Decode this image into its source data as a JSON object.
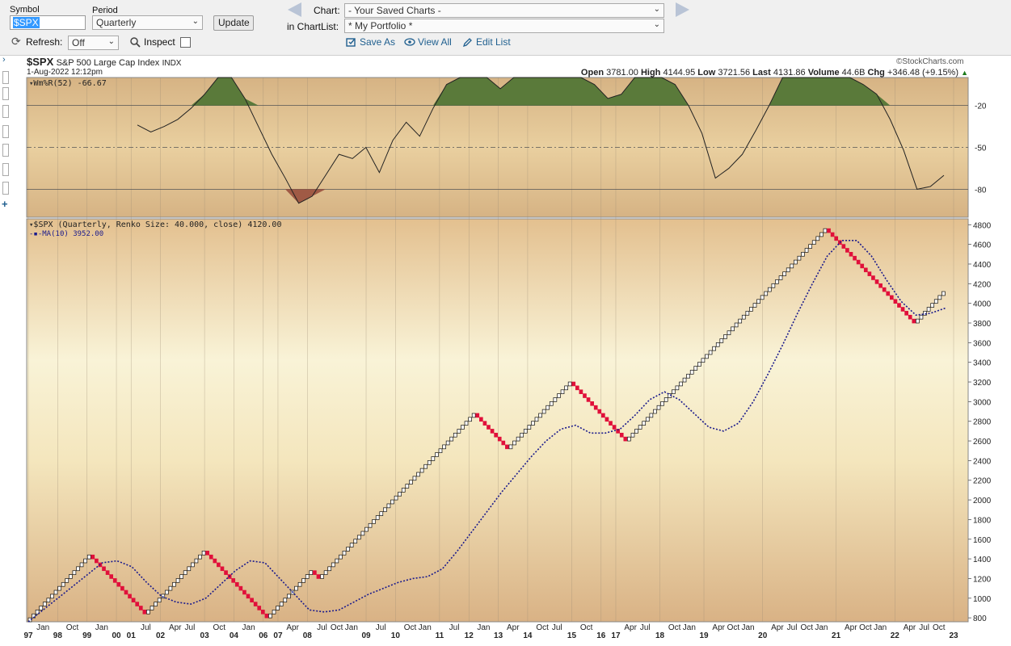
{
  "toolbar": {
    "symbol_label": "Symbol",
    "symbol_value": "$SPX",
    "period_label": "Period",
    "period_value": "Quarterly",
    "update_label": "Update",
    "refresh_label": "Refresh:",
    "refresh_value": "Off",
    "inspect_label": "Inspect",
    "chart_label": "Chart:",
    "chart_value": "- Your Saved Charts -",
    "chartlist_label": "in ChartList:",
    "chartlist_value": "* My Portfolio *",
    "save_as": "Save As",
    "view_all": "View All",
    "edit_list": "Edit List"
  },
  "header": {
    "symbol": "$SPX",
    "name": "S&P 500 Large Cap Index",
    "exchange": "INDX",
    "date": "1-Aug-2022 12:12pm",
    "brand": "©StockCharts.com",
    "open_label": "Open",
    "open": "3781.00",
    "high_label": "High",
    "high": "4144.95",
    "low_label": "Low",
    "low": "3721.56",
    "last_label": "Last",
    "last": "4131.86",
    "volume_label": "Volume",
    "volume": "44.6B",
    "chg_label": "Chg",
    "chg": "+346.48 (+9.15%)",
    "chg_arrow": "▲"
  },
  "colors": {
    "up_brick": "#ffffff",
    "down_brick": "#e0103a",
    "ma_line": "#1a1a8c",
    "overbought_fill": "#5a7a3a",
    "oversold_fill": "#a05a45"
  },
  "chart_data": [
    {
      "type": "line",
      "title": "Wm%R(52) -66.67",
      "ylim": [
        -100,
        0
      ],
      "yticks": [
        "-20",
        "-50",
        "-80"
      ],
      "reference_lines": [
        -20,
        -50,
        -80
      ],
      "overbought": -20,
      "oversold": -80,
      "x": [
        "1999-01",
        "1999-04",
        "1999-07",
        "2000-01",
        "2000-07",
        "2001-01",
        "2001-04",
        "2001-07",
        "2001-10",
        "2002-01",
        "2002-04",
        "2002-07",
        "2002-10",
        "2003-01",
        "2003-04",
        "2003-07",
        "2004-01",
        "2004-07",
        "2005-01",
        "2005-07",
        "2006-01",
        "2006-07",
        "2007-01",
        "2007-07",
        "2008-01",
        "2008-07",
        "2009-01",
        "2009-04",
        "2009-07",
        "2010-01",
        "2010-04",
        "2010-07",
        "2011-01",
        "2011-04",
        "2011-07",
        "2012-01",
        "2012-07",
        "2013-01",
        "2013-07",
        "2014-01",
        "2014-07",
        "2015-01",
        "2015-07",
        "2016-01",
        "2016-07",
        "2017-01",
        "2017-07",
        "2018-01",
        "2018-07",
        "2019-01",
        "2019-04",
        "2019-07",
        "2020-01",
        "2020-04",
        "2020-07",
        "2021-01",
        "2021-07",
        "2022-01",
        "2022-04",
        "2022-07",
        "2022-10"
      ],
      "values": [
        -34,
        -39,
        -35,
        -30,
        -22,
        -12,
        0,
        0,
        -15,
        -35,
        -55,
        -72,
        -90,
        -85,
        -70,
        -55,
        -58,
        -50,
        -68,
        -45,
        -32,
        -42,
        -22,
        -5,
        0,
        0,
        0,
        -8,
        0,
        0,
        0,
        0,
        0,
        0,
        -5,
        -15,
        -12,
        0,
        0,
        0,
        -5,
        -20,
        -40,
        -72,
        -65,
        -55,
        -38,
        -20,
        0,
        0,
        0,
        0,
        0,
        0,
        -5,
        -12,
        -30,
        -52,
        -80,
        -78,
        -70
      ],
      "x_tick_labels": []
    },
    {
      "type": "renko",
      "title": "$SPX (Quarterly, Renko Size: 40.000, close) 4120.00",
      "brick_size": 40,
      "ylim": [
        760,
        4860
      ],
      "yticks": [
        800,
        1000,
        1200,
        1400,
        1600,
        1800,
        2000,
        2200,
        2400,
        2600,
        2800,
        3000,
        3200,
        3400,
        3600,
        3800,
        4000,
        4200,
        4400,
        4600,
        4800
      ],
      "x_tick_labels": [
        "97",
        "Jan",
        "98",
        "Oct",
        "99",
        "Jan",
        "00",
        "01",
        "Jul",
        "02",
        "Apr",
        "Jul",
        "03",
        "Oct",
        "04",
        "Jan",
        "06",
        "07",
        "Apr",
        "08",
        "Jul",
        "Oct",
        "Jan",
        "09",
        "Jul",
        "10",
        "Oct",
        "Jan",
        "11",
        "Jul",
        "12",
        "Jan",
        "13",
        "Apr",
        "14",
        "Oct",
        "Jul",
        "15",
        "Oct",
        "16",
        "17",
        "Apr",
        "Jul",
        "18",
        "Oct",
        "Jan",
        "19",
        "Apr",
        "Oct",
        "Jan",
        "20",
        "Apr",
        "Jul",
        "Oct",
        "Jan",
        "21",
        "Apr",
        "Oct",
        "Jan",
        "22",
        "Apr",
        "Jul",
        "Oct",
        "23"
      ],
      "series": [
        {
          "name": "$SPX",
          "style": "renko",
          "reversal_points": [
            880,
            1460,
            840,
            1500,
            800,
            1140,
            1100,
            1300,
            1180,
            2000,
            1980,
            2880,
            2520,
            3200,
            2600,
            4760,
            3800,
            4120
          ]
        },
        {
          "name": "MA(10) 3952.00",
          "style": "dotted-line",
          "values": [
            760,
            880,
            1000,
            1120,
            1240,
            1360,
            1380,
            1320,
            1160,
            1020,
            960,
            940,
            1000,
            1140,
            1280,
            1380,
            1360,
            1200,
            1040,
            880,
            860,
            880,
            960,
            1040,
            1100,
            1160,
            1200,
            1220,
            1300,
            1480,
            1680,
            1880,
            2080,
            2260,
            2440,
            2600,
            2720,
            2760,
            2680,
            2680,
            2720,
            2860,
            3020,
            3100,
            3020,
            2880,
            2740,
            2700,
            2780,
            3000,
            3280,
            3580,
            3900,
            4200,
            4480,
            4640,
            4640,
            4480,
            4240,
            4020,
            3880,
            3900,
            3952
          ]
        }
      ]
    }
  ]
}
